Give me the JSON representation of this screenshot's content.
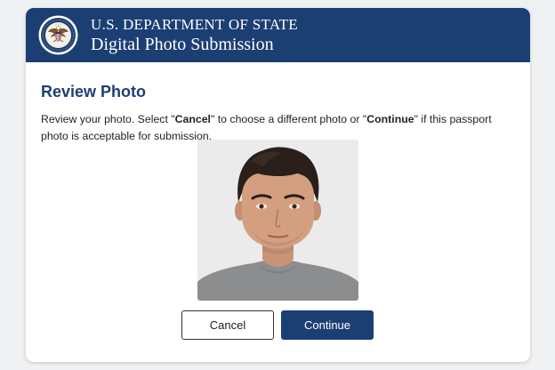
{
  "header": {
    "title": "U.S. DEPARTMENT OF STATE",
    "subtitle": "Digital Photo Submission",
    "seal_icon": "department-of-state-seal-icon",
    "background_color": "#1c3f73"
  },
  "main": {
    "page_title": "Review Photo",
    "instructions": {
      "part1": "Review your photo. Select \"",
      "cancel_word": "Cancel",
      "part2": "\"  to choose a different photo or \"",
      "continue_word": "Continue",
      "part3": "\" if this passport photo is acceptable for submission."
    },
    "photo": {
      "subject": "passport-photo-portrait"
    }
  },
  "actions": {
    "cancel_label": "Cancel",
    "continue_label": "Continue",
    "accent_color": "#1c3f73"
  }
}
